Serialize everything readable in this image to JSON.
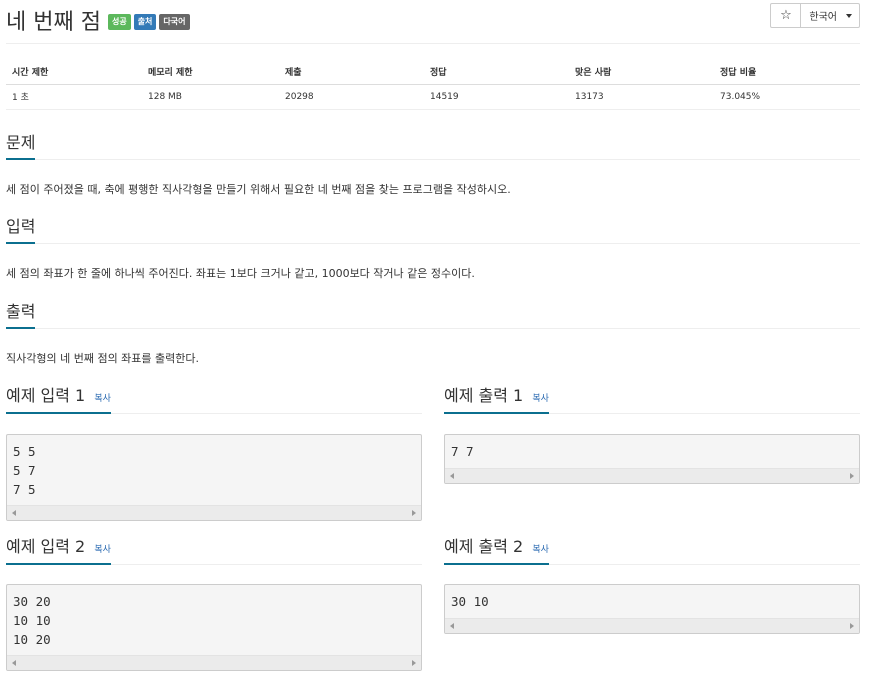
{
  "header": {
    "title": "네 번째 점",
    "badges": [
      {
        "label": "성공",
        "color": "#5cb85c"
      },
      {
        "label": "출처",
        "color": "#337ab7"
      },
      {
        "label": "다국어",
        "color": "#666666"
      }
    ],
    "star_icon": "☆",
    "language": "한국어"
  },
  "info_table": {
    "headers": [
      "시간 제한",
      "메모리 제한",
      "제출",
      "정답",
      "맞은 사람",
      "정답 비율"
    ],
    "values": [
      "1 초",
      "128 MB",
      "20298",
      "14519",
      "13173",
      "73.045%"
    ]
  },
  "sections": {
    "problem": {
      "title": "문제",
      "text": "세 점이 주어졌을 때, 축에 평행한 직사각형을 만들기 위해서 필요한 네 번째 점을 찾는 프로그램을 작성하시오."
    },
    "input": {
      "title": "입력",
      "text": "세 점의 좌표가 한 줄에 하나씩 주어진다. 좌표는 1보다 크거나 같고, 1000보다 작거나 같은 정수이다."
    },
    "output": {
      "title": "출력",
      "text": "직사각형의 네 번째 점의 좌표를 출력한다."
    }
  },
  "samples": {
    "copy_label": "복사",
    "input1": {
      "title": "예제 입력 1",
      "code": "5 5\n5 7\n7 5"
    },
    "output1": {
      "title": "예제 출력 1",
      "code": "7 7"
    },
    "input2": {
      "title": "예제 입력 2",
      "code": "30 20\n10 10\n10 20"
    },
    "output2": {
      "title": "예제 출력 2",
      "code": "30 10"
    }
  },
  "colors": {
    "accent": "#0b6f8f",
    "link": "#2a6ab1"
  }
}
